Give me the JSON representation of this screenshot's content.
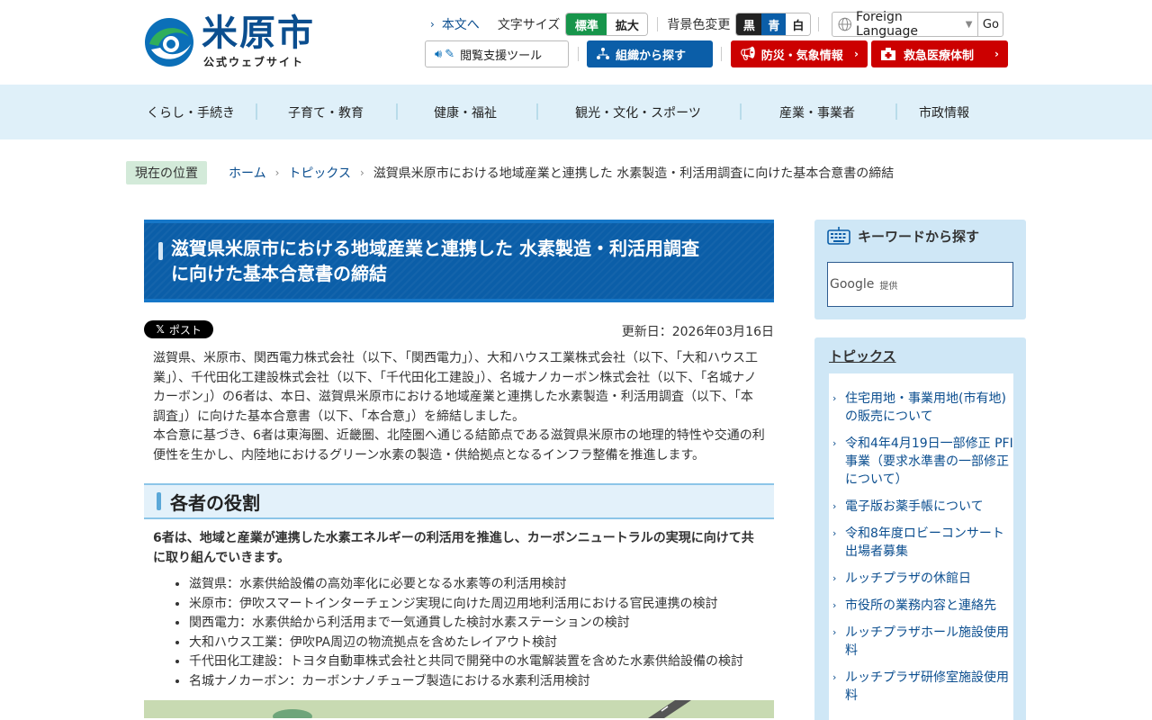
{
  "header": {
    "logo_name": "米原市",
    "logo_sub": "公式ウェブサイト",
    "skip_link": "本文へ",
    "font_size_label": "文字サイズ",
    "font_size_options": [
      "標準",
      "拡大"
    ],
    "bg_color_label": "背景色変更",
    "bg_color_options": [
      "黒",
      "青",
      "白"
    ],
    "language_select": "Foreign Language",
    "go_button": "Go",
    "assist_tool": "閲覧支援ツール",
    "org_search": "組織から探す",
    "disaster_info": "防災・気象情報",
    "emergency_medical": "救急医療体制"
  },
  "nav": {
    "items": [
      "くらし・手続き",
      "子育て・教育",
      "健康・福祉",
      "観光・文化・スポーツ",
      "産業・事業者",
      "市政情報"
    ]
  },
  "breadcrumb": {
    "tag": "現在の位置",
    "items": [
      "ホーム",
      "トピックス",
      "滋賀県米原市における地域産業と連携した 水素製造・利活用調査に向けた基本合意書の締結"
    ]
  },
  "article": {
    "title_line1": "滋賀県米原市における地域産業と連携した 水素製造・利活用調査",
    "title_line2": "に向けた基本合意書の締結",
    "x_post": "ポスト",
    "updated": "更新日：2026年03月16日",
    "paragraph1": "滋賀県、米原市、関西電力株式会社（以下、「関西電力」）、大和ハウス工業株式会社（以下、「大和ハウス工業」）、千代田化工建設株式会社（以下、「千代田化工建設」）、名城ナノカーボン株式会社（以下、「名城ナノカーボン」）の6者は、本日、滋賀県米原市における地域産業と連携した水素製造・利活用調査（以下、「本調査」）に向けた基本合意書（以下、「本合意」）を締結しました。",
    "paragraph2": "本合意に基づき、6者は東海圏、近畿圏、北陸圏へ通じる結節点である滋賀県米原市の地理的特性や交通の利便性を生かし、内陸地におけるグリーン水素の製造・供給拠点となるインフラ整備を推進します。",
    "section_heading": "各者の役割",
    "lead": "6者は、地域と産業が連携した水素エネルギーの利活用を推進し、カーボンニュートラルの実現に向けて共に取り組んでいきます。",
    "roles": [
      "滋賀県：水素供給設備の高効率化に必要となる水素等の利活用検討",
      "米原市：伊吹スマートインターチェンジ実現に向けた周辺用地利活用における官民連携の検討",
      "関西電力：水素供給から利活用まで一気通貫した検討水素ステーションの検討",
      "大和ハウス工業：伊吹PA周辺の物流拠点を含めたレイアウト検討",
      "千代田化工建設：トヨタ自動車株式会社と共同で開発中の水電解装置を含めた水素供給設備の検討",
      "名城ナノカーボン：カーボンナノチューブ製造における水素利活用検討"
    ]
  },
  "sidebar": {
    "keyword_heading": "キーワードから探す",
    "google_label": "Google",
    "google_provided": "提供",
    "topics_heading": "トピックス",
    "topics": [
      "住宅用地・事業用地(市有地)の販売について",
      "令和4年4月19日一部修正 PFI事業（要求水準書の一部修正について）",
      "電子版お薬手帳について",
      "令和8年度ロビーコンサート出場者募集",
      "ルッチプラザの休館日",
      "市役所の業務内容と連絡先",
      "ルッチプラザホール施設使用料",
      "ルッチプラザ研修室施設使用料"
    ]
  },
  "colors": {
    "brand_blue": "#0b4e8f",
    "green": "#17954b",
    "red": "#cc0000",
    "nav_bg": "#dff0f9"
  }
}
